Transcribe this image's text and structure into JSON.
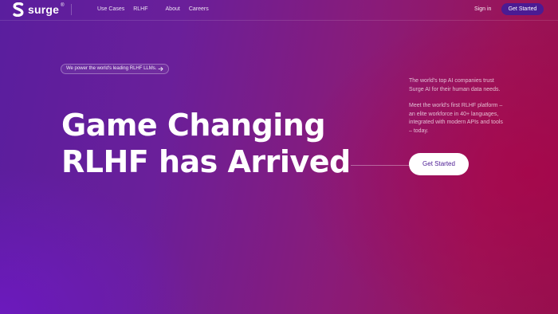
{
  "nav": {
    "logo_text": "surge",
    "logo_reg": "®",
    "links": [
      "Use Cases",
      "RLHF",
      "About",
      "Careers"
    ],
    "sign_in": "Sign in",
    "cta": "Get Started"
  },
  "hero": {
    "pill_text": "We power the world's leading RLHF LLMs.",
    "pill_icon": "arrow-right-icon",
    "title_line1": "Game Changing",
    "title_line2": "RLHF has Arrived",
    "desc_p1": "The world's top AI companies trust Surge AI for their human data needs.",
    "desc_p2": "Meet the world's first RLHF platform – an elite workforce in 40+ languages, integrated with modern APIs and tools – today.",
    "cta": "Get Started"
  },
  "colors": {
    "nav_cta_bg": "#4b1b93",
    "hero_cta_bg": "#ffffff",
    "hero_cta_text": "#4b1b93"
  }
}
